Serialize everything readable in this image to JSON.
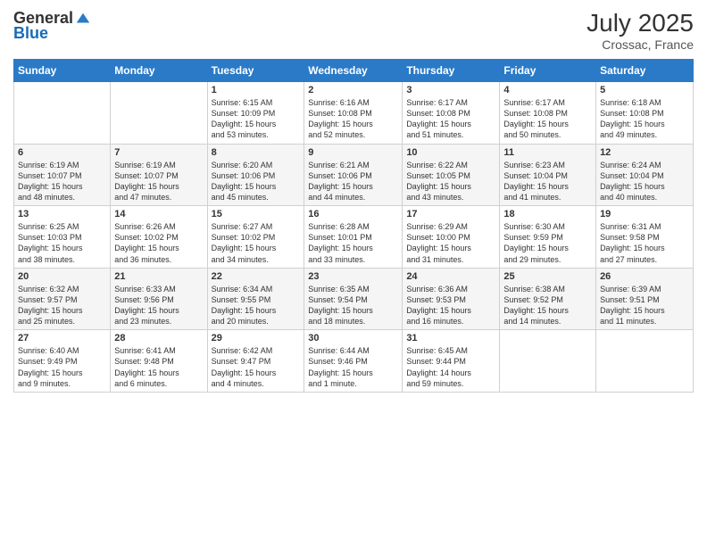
{
  "header": {
    "logo_general": "General",
    "logo_blue": "Blue",
    "month_year": "July 2025",
    "location": "Crossac, France"
  },
  "weekdays": [
    "Sunday",
    "Monday",
    "Tuesday",
    "Wednesday",
    "Thursday",
    "Friday",
    "Saturday"
  ],
  "weeks": [
    [
      {
        "day": "",
        "info": ""
      },
      {
        "day": "",
        "info": ""
      },
      {
        "day": "1",
        "info": "Sunrise: 6:15 AM\nSunset: 10:09 PM\nDaylight: 15 hours\nand 53 minutes."
      },
      {
        "day": "2",
        "info": "Sunrise: 6:16 AM\nSunset: 10:08 PM\nDaylight: 15 hours\nand 52 minutes."
      },
      {
        "day": "3",
        "info": "Sunrise: 6:17 AM\nSunset: 10:08 PM\nDaylight: 15 hours\nand 51 minutes."
      },
      {
        "day": "4",
        "info": "Sunrise: 6:17 AM\nSunset: 10:08 PM\nDaylight: 15 hours\nand 50 minutes."
      },
      {
        "day": "5",
        "info": "Sunrise: 6:18 AM\nSunset: 10:08 PM\nDaylight: 15 hours\nand 49 minutes."
      }
    ],
    [
      {
        "day": "6",
        "info": "Sunrise: 6:19 AM\nSunset: 10:07 PM\nDaylight: 15 hours\nand 48 minutes."
      },
      {
        "day": "7",
        "info": "Sunrise: 6:19 AM\nSunset: 10:07 PM\nDaylight: 15 hours\nand 47 minutes."
      },
      {
        "day": "8",
        "info": "Sunrise: 6:20 AM\nSunset: 10:06 PM\nDaylight: 15 hours\nand 45 minutes."
      },
      {
        "day": "9",
        "info": "Sunrise: 6:21 AM\nSunset: 10:06 PM\nDaylight: 15 hours\nand 44 minutes."
      },
      {
        "day": "10",
        "info": "Sunrise: 6:22 AM\nSunset: 10:05 PM\nDaylight: 15 hours\nand 43 minutes."
      },
      {
        "day": "11",
        "info": "Sunrise: 6:23 AM\nSunset: 10:04 PM\nDaylight: 15 hours\nand 41 minutes."
      },
      {
        "day": "12",
        "info": "Sunrise: 6:24 AM\nSunset: 10:04 PM\nDaylight: 15 hours\nand 40 minutes."
      }
    ],
    [
      {
        "day": "13",
        "info": "Sunrise: 6:25 AM\nSunset: 10:03 PM\nDaylight: 15 hours\nand 38 minutes."
      },
      {
        "day": "14",
        "info": "Sunrise: 6:26 AM\nSunset: 10:02 PM\nDaylight: 15 hours\nand 36 minutes."
      },
      {
        "day": "15",
        "info": "Sunrise: 6:27 AM\nSunset: 10:02 PM\nDaylight: 15 hours\nand 34 minutes."
      },
      {
        "day": "16",
        "info": "Sunrise: 6:28 AM\nSunset: 10:01 PM\nDaylight: 15 hours\nand 33 minutes."
      },
      {
        "day": "17",
        "info": "Sunrise: 6:29 AM\nSunset: 10:00 PM\nDaylight: 15 hours\nand 31 minutes."
      },
      {
        "day": "18",
        "info": "Sunrise: 6:30 AM\nSunset: 9:59 PM\nDaylight: 15 hours\nand 29 minutes."
      },
      {
        "day": "19",
        "info": "Sunrise: 6:31 AM\nSunset: 9:58 PM\nDaylight: 15 hours\nand 27 minutes."
      }
    ],
    [
      {
        "day": "20",
        "info": "Sunrise: 6:32 AM\nSunset: 9:57 PM\nDaylight: 15 hours\nand 25 minutes."
      },
      {
        "day": "21",
        "info": "Sunrise: 6:33 AM\nSunset: 9:56 PM\nDaylight: 15 hours\nand 23 minutes."
      },
      {
        "day": "22",
        "info": "Sunrise: 6:34 AM\nSunset: 9:55 PM\nDaylight: 15 hours\nand 20 minutes."
      },
      {
        "day": "23",
        "info": "Sunrise: 6:35 AM\nSunset: 9:54 PM\nDaylight: 15 hours\nand 18 minutes."
      },
      {
        "day": "24",
        "info": "Sunrise: 6:36 AM\nSunset: 9:53 PM\nDaylight: 15 hours\nand 16 minutes."
      },
      {
        "day": "25",
        "info": "Sunrise: 6:38 AM\nSunset: 9:52 PM\nDaylight: 15 hours\nand 14 minutes."
      },
      {
        "day": "26",
        "info": "Sunrise: 6:39 AM\nSunset: 9:51 PM\nDaylight: 15 hours\nand 11 minutes."
      }
    ],
    [
      {
        "day": "27",
        "info": "Sunrise: 6:40 AM\nSunset: 9:49 PM\nDaylight: 15 hours\nand 9 minutes."
      },
      {
        "day": "28",
        "info": "Sunrise: 6:41 AM\nSunset: 9:48 PM\nDaylight: 15 hours\nand 6 minutes."
      },
      {
        "day": "29",
        "info": "Sunrise: 6:42 AM\nSunset: 9:47 PM\nDaylight: 15 hours\nand 4 minutes."
      },
      {
        "day": "30",
        "info": "Sunrise: 6:44 AM\nSunset: 9:46 PM\nDaylight: 15 hours\nand 1 minute."
      },
      {
        "day": "31",
        "info": "Sunrise: 6:45 AM\nSunset: 9:44 PM\nDaylight: 14 hours\nand 59 minutes."
      },
      {
        "day": "",
        "info": ""
      },
      {
        "day": "",
        "info": ""
      }
    ]
  ]
}
